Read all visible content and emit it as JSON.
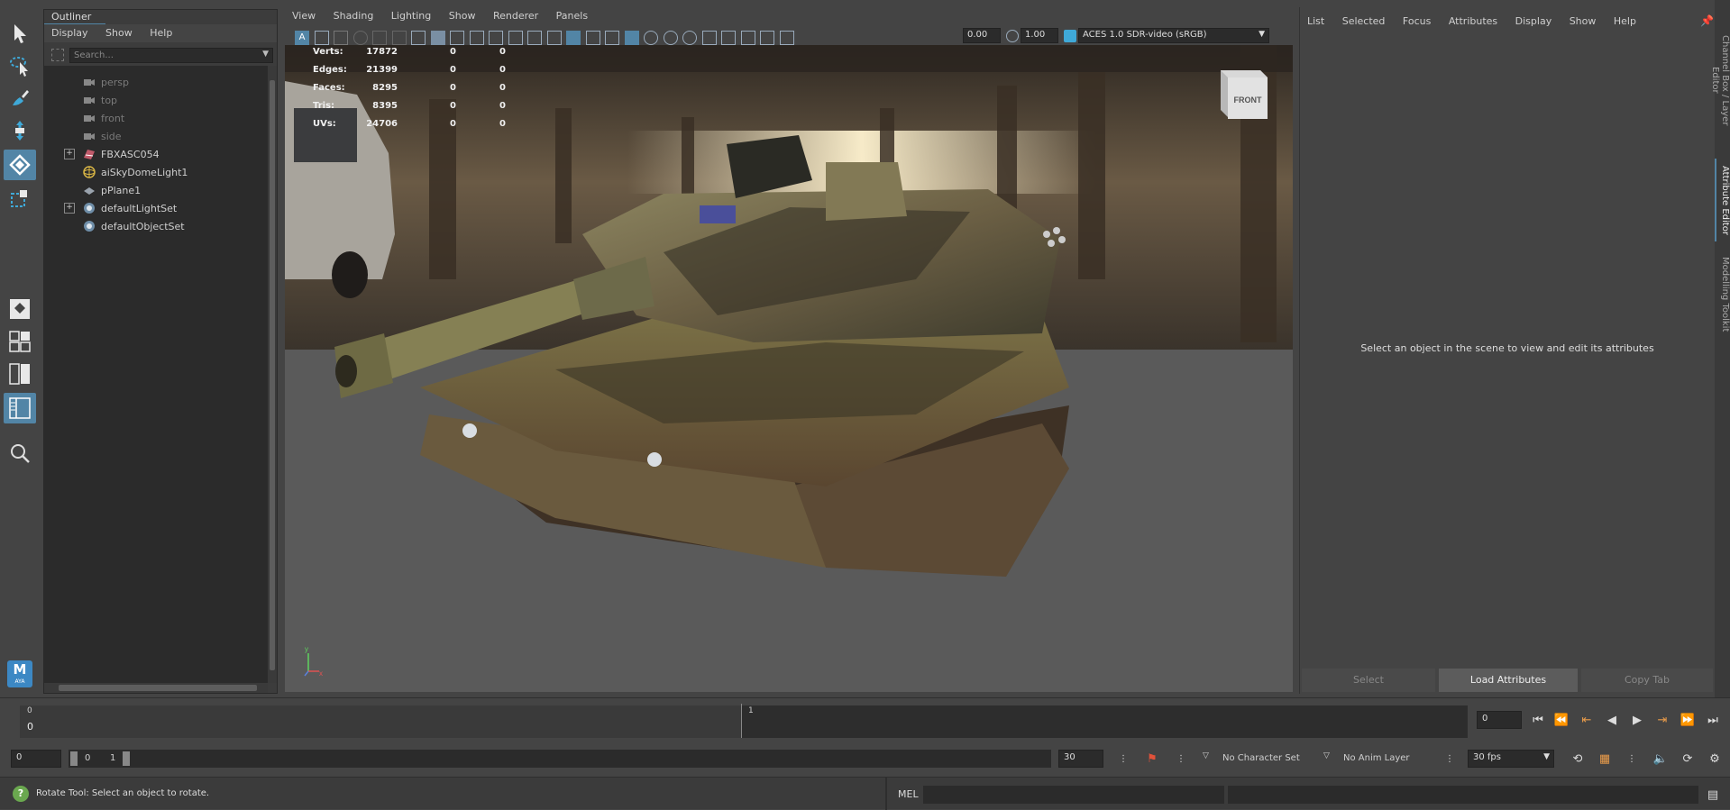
{
  "toolbox": {
    "tools": [
      "select-tool-icon",
      "lasso-tool-icon",
      "paint-select-tool-icon",
      "move-tool-icon",
      "rotate-tool-icon",
      "scale-tool-icon"
    ],
    "layouts": [
      "single-pane-layout-icon",
      "four-pane-layout-icon",
      "two-pane-layout-icon",
      "outliner-persp-layout-icon"
    ],
    "search_icon": "search-icon",
    "app_badge": "M",
    "app_badge_sub": "AYA"
  },
  "outliner": {
    "title": "Outliner",
    "menu": [
      "Display",
      "Show",
      "Help"
    ],
    "search_placeholder": "Search...",
    "items": [
      {
        "label": "persp",
        "icon": "camera-icon",
        "dim": true,
        "expandable": false
      },
      {
        "label": "top",
        "icon": "camera-icon",
        "dim": true,
        "expandable": false
      },
      {
        "label": "front",
        "icon": "camera-icon",
        "dim": true,
        "expandable": false
      },
      {
        "label": "side",
        "icon": "camera-icon",
        "dim": true,
        "expandable": false
      },
      {
        "label": "FBXASC054",
        "icon": "mesh-group-icon",
        "dim": false,
        "expandable": true
      },
      {
        "label": "aiSkyDomeLight1",
        "icon": "skydome-light-icon",
        "dim": false,
        "expandable": false
      },
      {
        "label": "pPlane1",
        "icon": "plane-mesh-icon",
        "dim": false,
        "expandable": false
      },
      {
        "label": "defaultLightSet",
        "icon": "set-icon",
        "dim": false,
        "expandable": true
      },
      {
        "label": "defaultObjectSet",
        "icon": "set-icon",
        "dim": false,
        "expandable": false
      }
    ]
  },
  "viewport": {
    "menu": [
      "View",
      "Shading",
      "Lighting",
      "Show",
      "Renderer",
      "Panels"
    ],
    "exposure": "0.00",
    "gamma": "1.00",
    "color_space": "ACES 1.0 SDR-video (sRGB)",
    "view_cube_label": "FRONT",
    "hud": [
      {
        "label": "Verts:",
        "v1": "17872",
        "v2": "0",
        "v3": "0"
      },
      {
        "label": "Edges:",
        "v1": "21399",
        "v2": "0",
        "v3": "0"
      },
      {
        "label": "Faces:",
        "v1": "8295",
        "v2": "0",
        "v3": "0"
      },
      {
        "label": "Tris:",
        "v1": "8395",
        "v2": "0",
        "v3": "0"
      },
      {
        "label": "UVs:",
        "v1": "24706",
        "v2": "0",
        "v3": "0"
      }
    ],
    "axis": {
      "y": "y",
      "x": "x"
    }
  },
  "attribute_editor": {
    "menu": [
      "List",
      "Selected",
      "Focus",
      "Attributes",
      "Display",
      "Show",
      "Help"
    ],
    "message": "Select an object in the scene to view and edit its attributes",
    "buttons": {
      "select": "Select",
      "load": "Load Attributes",
      "copy": "Copy Tab"
    }
  },
  "side_tabs": [
    "Channel Box / Layer Editor",
    "Attribute Editor",
    "Modelling Toolkit"
  ],
  "time_slider": {
    "start_label": "0",
    "start_tick": "0",
    "mid_tick": "1",
    "current_frame": "0"
  },
  "range": {
    "start": "0",
    "inner_start": "0",
    "inner_end": "1",
    "end": "30",
    "character_set": "No Character Set",
    "anim_layer": "No Anim Layer",
    "fps": "30 fps"
  },
  "status": {
    "help_text": "Rotate Tool: Select an object to rotate.",
    "mel_label": "MEL"
  },
  "colors": {
    "accent": "#5285a6",
    "panel": "#444444",
    "field": "#2b2b2b"
  }
}
